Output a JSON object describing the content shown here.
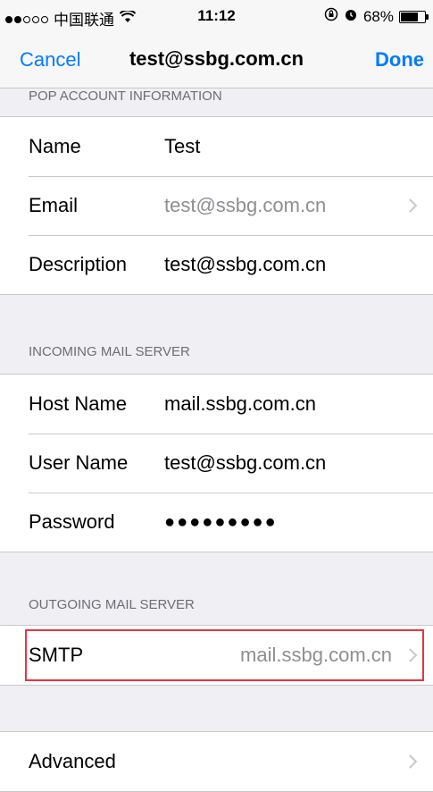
{
  "status_bar": {
    "carrier": "中国联通",
    "time": "11:12",
    "battery_percent": "68%",
    "signal_bars_filled": 2,
    "signal_bars_total": 5
  },
  "nav": {
    "cancel_label": "Cancel",
    "title": "test@ssbg.com.cn",
    "done_label": "Done"
  },
  "pop_section": {
    "header": "POP ACCOUNT INFORMATION",
    "name_label": "Name",
    "name_value": "Test",
    "email_label": "Email",
    "email_value": "test@ssbg.com.cn",
    "description_label": "Description",
    "description_value": "test@ssbg.com.cn"
  },
  "incoming_section": {
    "header": "INCOMING MAIL SERVER",
    "host_label": "Host Name",
    "host_value": "mail.ssbg.com.cn",
    "user_label": "User Name",
    "user_value": "test@ssbg.com.cn",
    "password_label": "Password",
    "password_value": "●●●●●●●●●"
  },
  "outgoing_section": {
    "header": "OUTGOING MAIL SERVER",
    "smtp_label": "SMTP",
    "smtp_value": "mail.ssbg.com.cn"
  },
  "advanced": {
    "label": "Advanced"
  },
  "colors": {
    "accent": "#007aff",
    "highlight_box": "#e8343f",
    "background": "#efeff4"
  }
}
